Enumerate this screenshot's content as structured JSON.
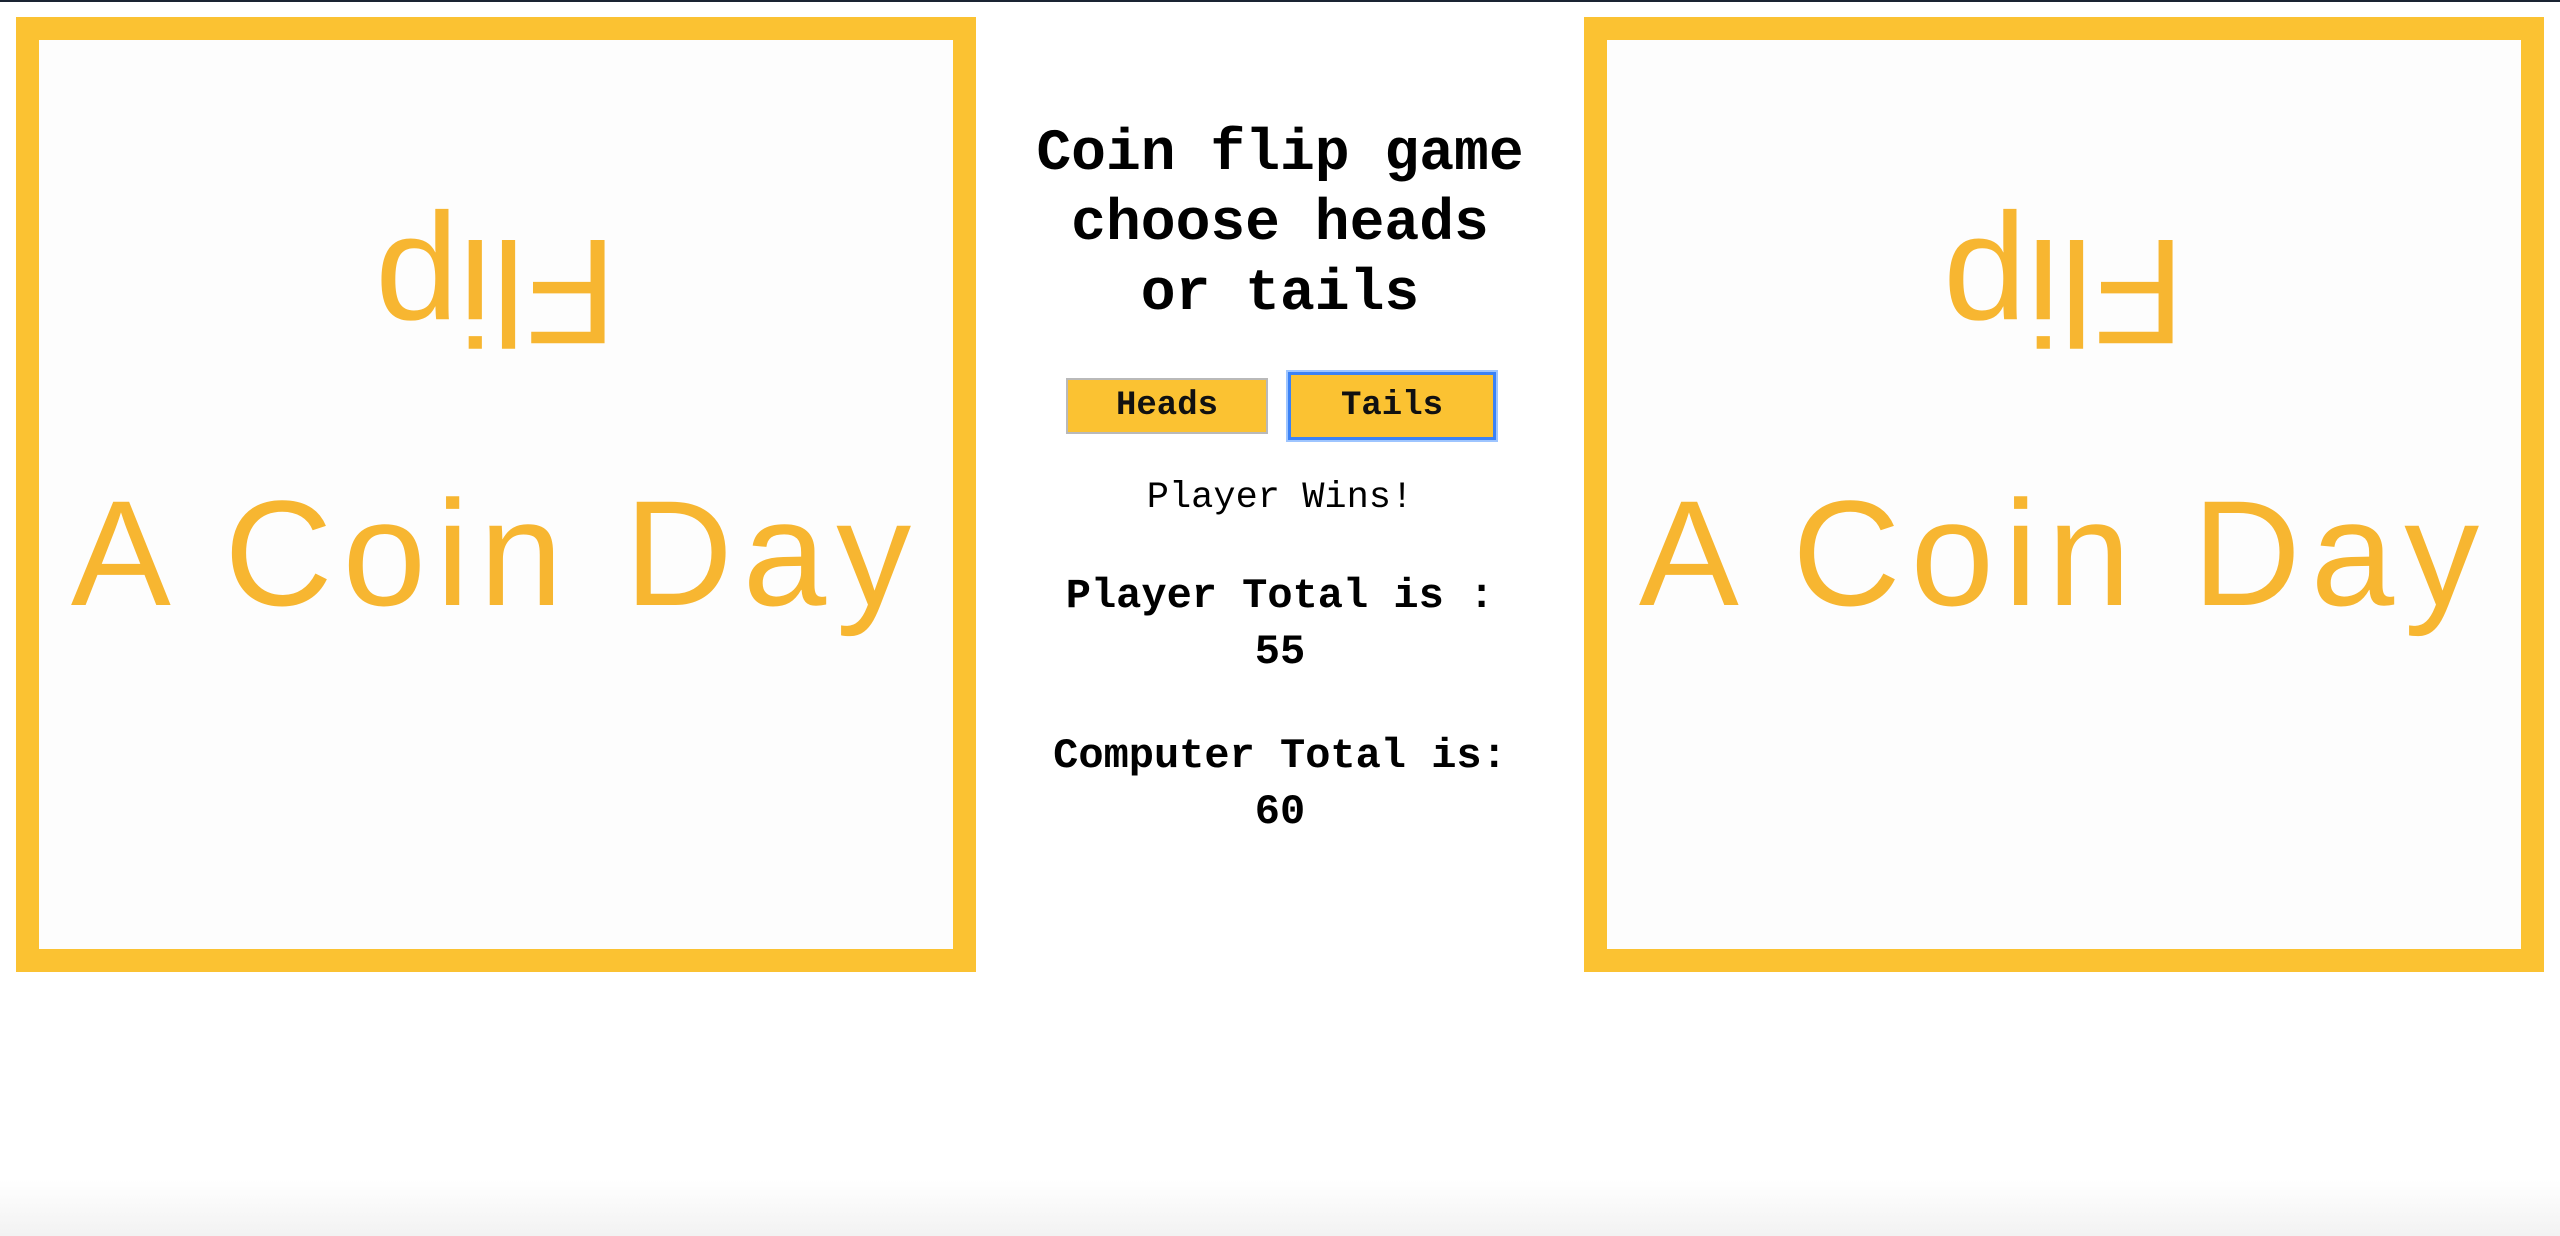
{
  "logo": {
    "flipped_word": "Flip",
    "tagline": "A Coin Day",
    "color": "#fbc232"
  },
  "game": {
    "title_lines": [
      "Coin flip game",
      "choose heads",
      "or tails"
    ],
    "buttons": {
      "heads": "Heads",
      "tails": "Tails"
    },
    "result": "Player Wins!",
    "player_label": "Player Total is :",
    "player_total": "55",
    "computer_label": "Computer Total is:",
    "computer_total": "60"
  },
  "colors": {
    "accent": "#fbc232",
    "focus": "#3b82f6"
  }
}
